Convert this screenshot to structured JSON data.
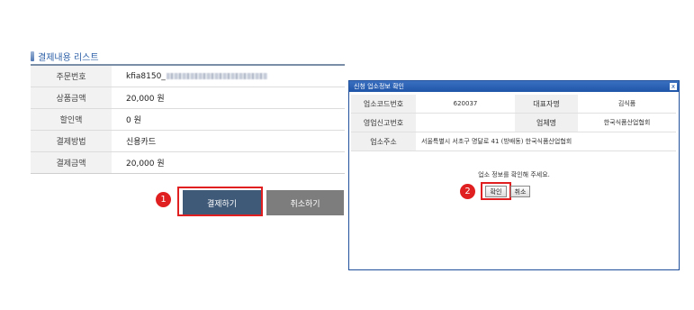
{
  "section_title": "결제내용 리스트",
  "order_rows": [
    {
      "label": "주문번호",
      "value": "kfia8150_"
    },
    {
      "label": "상품금액",
      "value": "20,000 원"
    },
    {
      "label": "할인액",
      "value": "0 원"
    },
    {
      "label": "결제방법",
      "value": "신용카드"
    },
    {
      "label": "결제금액",
      "value": "20,000 원"
    }
  ],
  "buttons": {
    "pay": "결제하기",
    "cancel": "취소하기"
  },
  "steps": {
    "one": "1",
    "two": "2"
  },
  "popup": {
    "title": "신청 업소정보 확인",
    "close": "x",
    "fields": {
      "code_label": "업소코드번호",
      "code_value": "620037",
      "rep_label": "대표자명",
      "rep_value": "김식품",
      "license_label": "영업신고번호",
      "license_value": "",
      "company_label": "업체명",
      "company_value": "한국식품산업협회",
      "addr_label": "업소주소",
      "addr_value": "서울특별시 서초구 명달로 41 (방배동) 한국식품산업협회"
    },
    "message": "업소 정보를 확인해 주세요.",
    "ok": "확인",
    "cancel": "취소"
  },
  "colors": {
    "highlight": "#e02020",
    "pay_button": "#3f5a78",
    "popup_title": "#1f55a8"
  }
}
